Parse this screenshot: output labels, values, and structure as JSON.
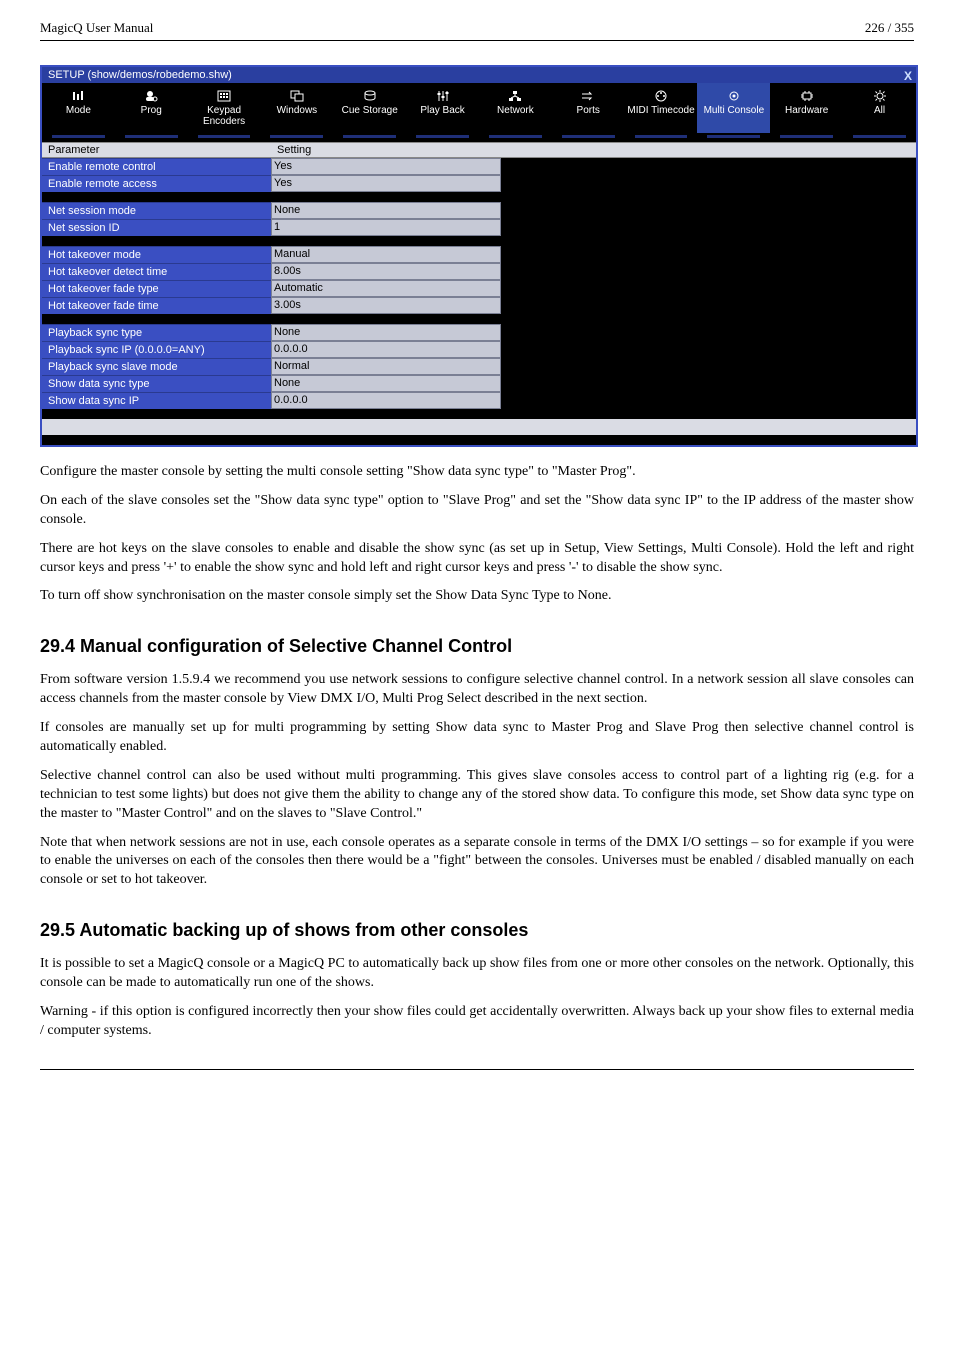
{
  "header": {
    "left": "MagicQ User Manual",
    "right": "226 / 355"
  },
  "screenshot": {
    "title": "SETUP (show/demos/robedemo.shw)",
    "tabs": [
      {
        "name": "mode",
        "label": "Mode"
      },
      {
        "name": "prog",
        "label": "Prog"
      },
      {
        "name": "keypad-encoders",
        "label": "Keypad Encoders"
      },
      {
        "name": "windows",
        "label": "Windows"
      },
      {
        "name": "cue-storage",
        "label": "Cue Storage"
      },
      {
        "name": "play-back",
        "label": "Play Back"
      },
      {
        "name": "network",
        "label": "Network"
      },
      {
        "name": "ports",
        "label": "Ports"
      },
      {
        "name": "midi-timecode",
        "label": "MIDI Timecode"
      },
      {
        "name": "multi-console",
        "label": "Multi Console"
      },
      {
        "name": "hardware",
        "label": "Hardware"
      },
      {
        "name": "all",
        "label": "All"
      }
    ],
    "head": {
      "param": "Parameter",
      "setting": "Setting"
    },
    "groups": [
      [
        {
          "param": "Enable remote control",
          "value": "Yes"
        },
        {
          "param": "Enable remote access",
          "value": "Yes"
        }
      ],
      [
        {
          "param": "Net session mode",
          "value": "None"
        },
        {
          "param": "Net session ID",
          "value": "1"
        }
      ],
      [
        {
          "param": "Hot takeover mode",
          "value": "Manual"
        },
        {
          "param": "Hot takeover detect time",
          "value": "8.00s"
        },
        {
          "param": "Hot takeover fade type",
          "value": "Automatic"
        },
        {
          "param": "Hot takeover fade time",
          "value": "3.00s"
        }
      ],
      [
        {
          "param": "Playback sync type",
          "value": "None"
        },
        {
          "param": "Playback sync IP (0.0.0.0=ANY)",
          "value": "0.0.0.0"
        },
        {
          "param": "Playback sync slave mode",
          "value": "Normal"
        },
        {
          "param": "Show data sync type",
          "value": "None"
        },
        {
          "param": "Show data sync IP",
          "value": "0.0.0.0"
        }
      ]
    ]
  },
  "paragraphs": {
    "p1": "Configure the master console by setting the multi console setting \"Show data sync type\" to \"Master Prog\".",
    "p2": "On each of the slave consoles set the \"Show data sync type\" option to \"Slave Prog\" and set the \"Show data sync IP\" to the IP address of the master show console.",
    "p3": "There are hot keys on the slave consoles to enable and disable the show sync (as set up in Setup, View Settings, Multi Console). Hold the left and right cursor keys and press '+' to enable the show sync and hold left and right cursor keys and press '-' to disable the show sync.",
    "p4": "To turn off show synchronisation on the master console simply set the Show Data Sync Type to None.",
    "p5": "From software version 1.5.9.4 we recommend you use network sessions to configure selective channel control. In a network session all slave consoles can access channels from the master console by View DMX I/O, Multi Prog Select described in the next section.",
    "p6": "If consoles are manually set up for multi programming by setting Show data sync to Master Prog and Slave Prog then selective channel control is automatically enabled.",
    "p7": "Selective channel control can also be used without multi programming. This gives slave consoles access to control part of a lighting rig (e.g. for a technician to test some lights) but does not give them the ability to change any of the stored show data. To configure this mode, set Show data sync type on the master to \"Master Control\" and on the slaves to \"Slave Control.\"",
    "p8": "Note that when network sessions are not in use, each console operates as a separate console in terms of the DMX I/O settings – so for example if you were to enable the universes on each of the consoles then there would be a \"fight\" between the consoles. Universes must be enabled / disabled manually on each console or set to hot takeover.",
    "p9": "It is possible to set a MagicQ console or a MagicQ PC to automatically back up show files from one or more other consoles on the network. Optionally, this console can be made to automatically run one of the shows.",
    "p10": "Warning - if this option is configured incorrectly then your show files could get accidentally overwritten. Always back up your show files to external media / computer systems."
  },
  "sections": {
    "s1": "29.4   Manual configuration of Selective Channel Control",
    "s2": "29.5   Automatic backing up of shows from other consoles"
  }
}
